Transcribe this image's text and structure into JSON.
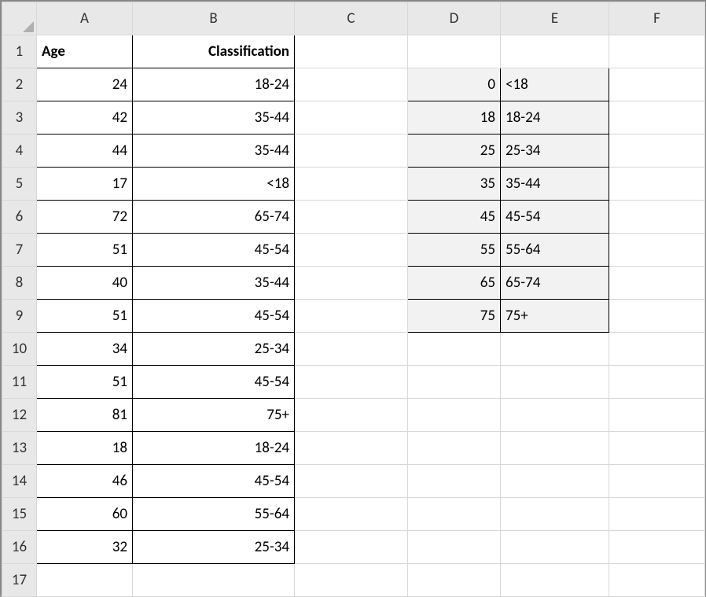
{
  "cols": {
    "A": "A",
    "B": "B",
    "C": "C",
    "D": "D",
    "E": "E",
    "F": "F"
  },
  "rows": [
    "1",
    "2",
    "3",
    "4",
    "5",
    "6",
    "7",
    "8",
    "9",
    "10",
    "11",
    "12",
    "13",
    "14",
    "15",
    "16",
    "17"
  ],
  "header": {
    "age": "Age",
    "class": "Classification"
  },
  "data": [
    {
      "age": "24",
      "class": "18-24"
    },
    {
      "age": "42",
      "class": "35-44"
    },
    {
      "age": "44",
      "class": "35-44"
    },
    {
      "age": "17",
      "class": "<18"
    },
    {
      "age": "72",
      "class": "65-74"
    },
    {
      "age": "51",
      "class": "45-54"
    },
    {
      "age": "40",
      "class": "35-44"
    },
    {
      "age": "51",
      "class": "45-54"
    },
    {
      "age": "34",
      "class": "25-34"
    },
    {
      "age": "51",
      "class": "45-54"
    },
    {
      "age": "81",
      "class": "75+"
    },
    {
      "age": "18",
      "class": "18-24"
    },
    {
      "age": "46",
      "class": "45-54"
    },
    {
      "age": "60",
      "class": "55-64"
    },
    {
      "age": "32",
      "class": "25-34"
    }
  ],
  "lookup": [
    {
      "k": "0",
      "v": "<18"
    },
    {
      "k": "18",
      "v": "18-24"
    },
    {
      "k": "25",
      "v": "25-34"
    },
    {
      "k": "35",
      "v": "35-44"
    },
    {
      "k": "45",
      "v": "45-54"
    },
    {
      "k": "55",
      "v": "55-64"
    },
    {
      "k": "65",
      "v": "65-74"
    },
    {
      "k": "75",
      "v": "75+"
    }
  ]
}
